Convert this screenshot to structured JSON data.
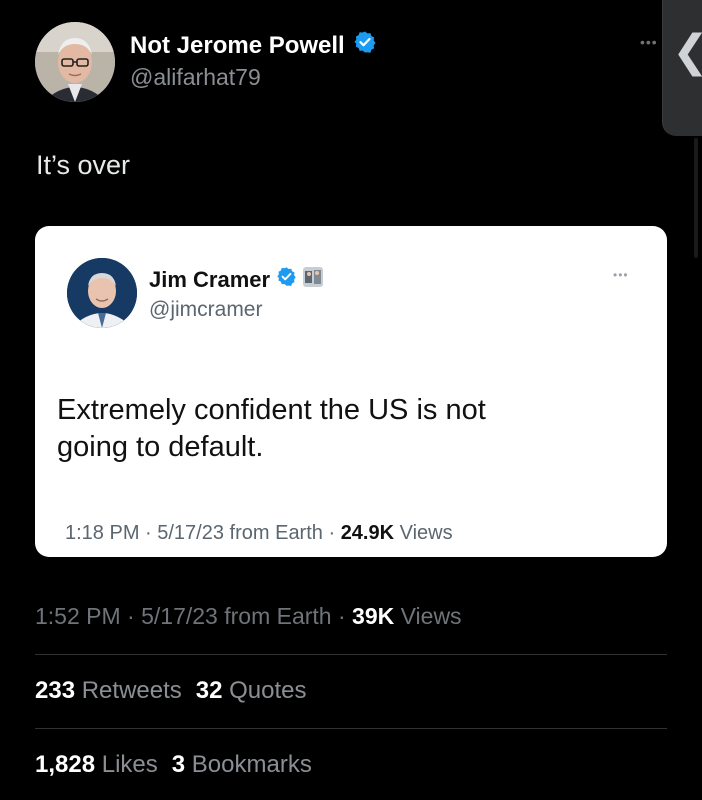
{
  "author": {
    "display_name": "Not Jerome Powell",
    "handle": "@alifarhat79",
    "verified": true
  },
  "tweet_text": "It’s over",
  "quoted": {
    "display_name": "Jim Cramer",
    "handle": "@jimcramer",
    "text_line1": "Extremely confident the US is not",
    "text_line2": "going to default.",
    "time": "1:18 PM · 5/17/23 from Earth · ",
    "views_count": "24.9K",
    "views_label": " Views"
  },
  "meta": {
    "time": "1:52 PM · 5/17/23 from Earth · ",
    "views_count": "39K",
    "views_label": " Views"
  },
  "stats": {
    "retweets_count": "233",
    "retweets_label": " Retweets",
    "quotes_count": "32",
    "quotes_label": " Quotes",
    "likes_count": "1,828",
    "likes_label": " Likes",
    "bookmarks_count": "3",
    "bookmarks_label": " Bookmarks"
  },
  "colors": {
    "background": "#000000",
    "verified_blue": "#1d9bf0",
    "muted_text": "#8b8f94"
  },
  "icons": [
    "verified-badge-icon",
    "more-icon",
    "chevron-left-icon"
  ]
}
